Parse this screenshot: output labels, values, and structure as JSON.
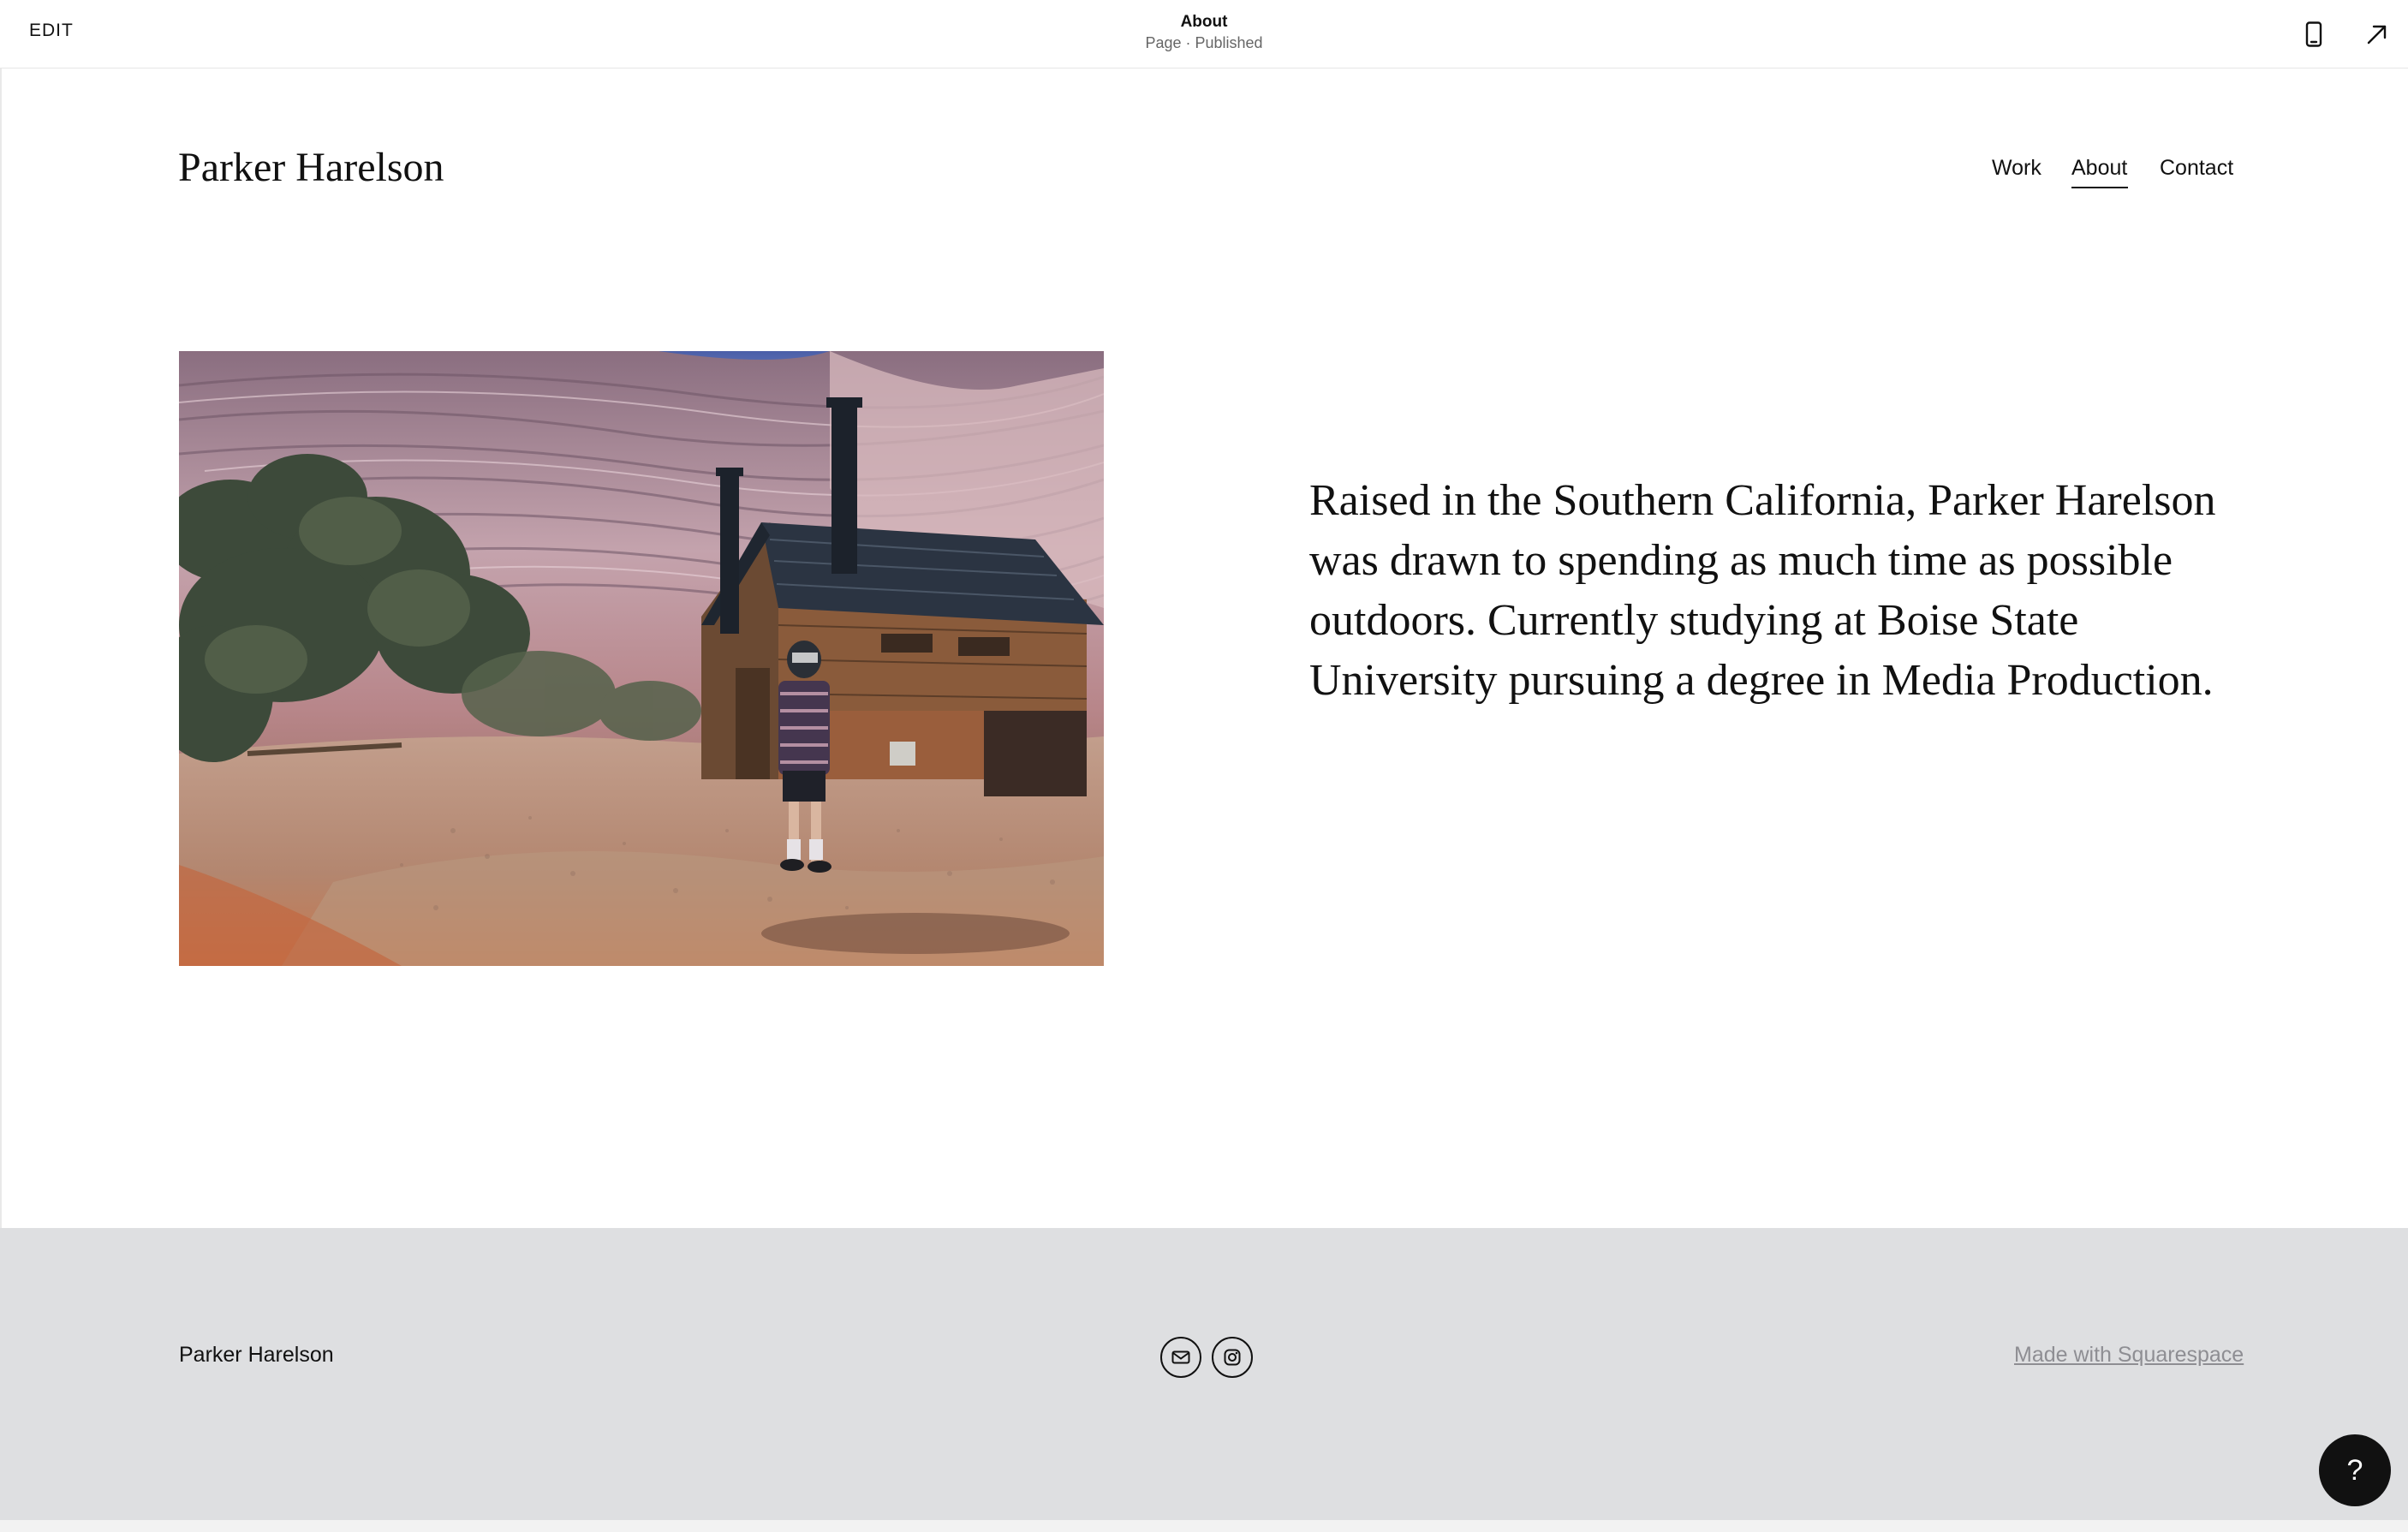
{
  "editor_bar": {
    "edit_label": "EDIT",
    "page_title": "About",
    "page_status": "Page · Published",
    "icons": [
      "mobile-preview-icon",
      "open-external-arrow-icon"
    ]
  },
  "site": {
    "title": "Parker Harelson",
    "nav": {
      "work": "Work",
      "about": "About",
      "contact": "Contact",
      "active": "About"
    }
  },
  "bio": {
    "text": "Raised in the Southern California, Parker Harelson was drawn to spending as much time as possible outdoors. Currently studying at Boise State University pursuing a degree in Media Production."
  },
  "footer": {
    "name": "Parker Harelson",
    "social_icons": [
      "email-icon",
      "instagram-icon"
    ],
    "made_with": "Made with Squarespace",
    "background": "#dedfe1"
  },
  "help": {
    "label": "?"
  }
}
